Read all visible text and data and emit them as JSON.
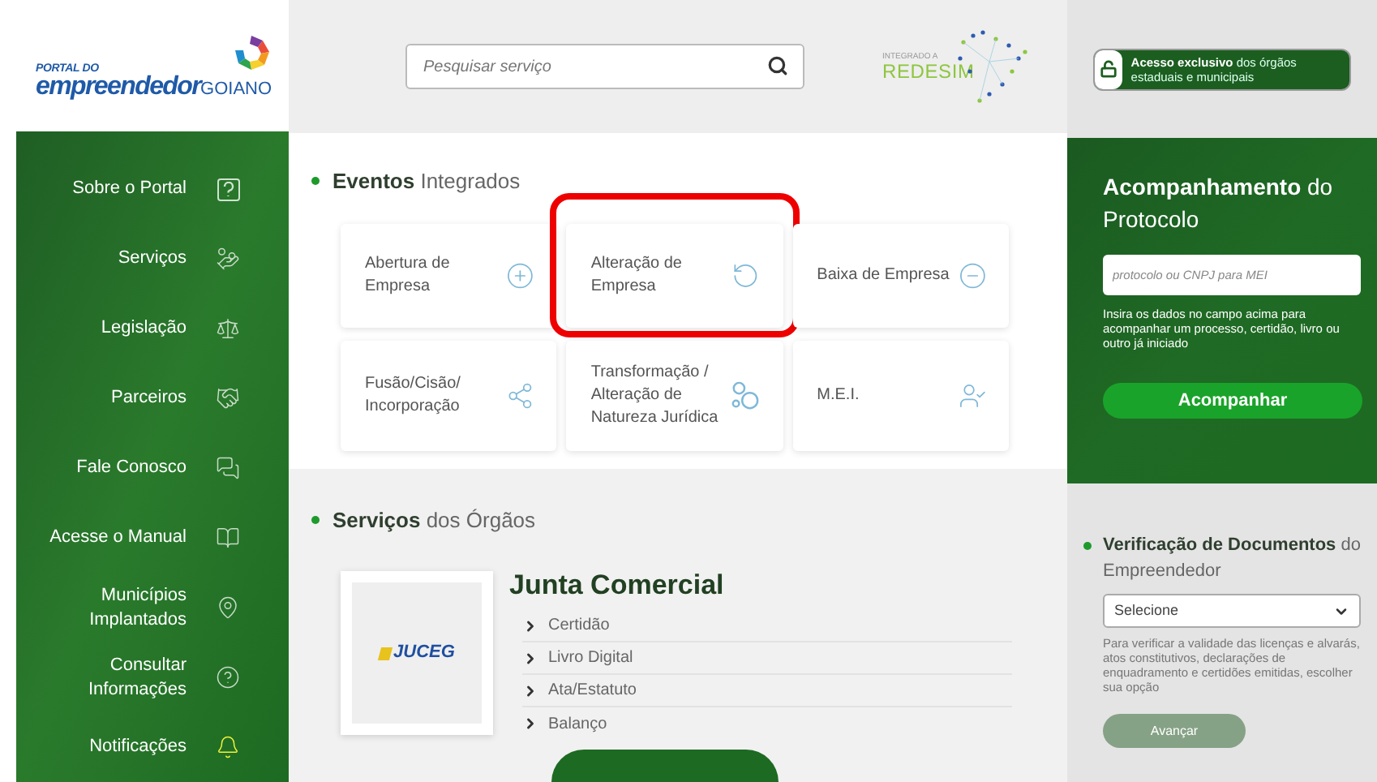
{
  "logo": {
    "top": "PORTAL DO",
    "main": "empreendedor",
    "suffix": "GOIANO"
  },
  "search": {
    "placeholder": "Pesquisar serviço"
  },
  "redesim": {
    "caption": "INTEGRADO A",
    "name": "REDESIM"
  },
  "access_button": {
    "bold": "Acesso exclusivo",
    "rest": "dos órgãos estaduais e municipais"
  },
  "sidebar": {
    "items": [
      {
        "label": "Sobre o Portal"
      },
      {
        "label": "Serviços"
      },
      {
        "label": "Legislação"
      },
      {
        "label": "Parceiros"
      },
      {
        "label": "Fale Conosco"
      },
      {
        "label": "Acesse o Manual"
      },
      {
        "label": "Municípios Implantados"
      },
      {
        "label": "Consultar Informações"
      },
      {
        "label": "Notificações"
      }
    ]
  },
  "events": {
    "title_bold": "Eventos",
    "title_rest": "Integrados",
    "cards": [
      {
        "label": "Abertura de Empresa",
        "highlighted": false
      },
      {
        "label": "Alteração de Empresa",
        "highlighted": true
      },
      {
        "label": "Baixa de Empresa",
        "highlighted": false
      },
      {
        "label": "Fusão/Cisão/ Incorporação",
        "highlighted": false
      },
      {
        "label": "Transformação / Alteração de Natureza Jurídica",
        "highlighted": false
      },
      {
        "label": "M.E.I.",
        "highlighted": false
      }
    ]
  },
  "services": {
    "title_bold": "Serviços",
    "title_rest": "dos Órgãos",
    "organ": {
      "logo": "JUCEG",
      "name": "Junta Comercial",
      "links": [
        "Certidão",
        "Livro Digital",
        "Ata/Estatuto",
        "Balanço"
      ]
    }
  },
  "tracking": {
    "title_bold": "Acompanhamento",
    "title_rest": "do Protocolo",
    "placeholder": "protocolo ou CNPJ para MEI",
    "help": "Insira os dados no campo acima para acompanhar um processo, certidão, livro ou outro já iniciado",
    "button": "Acompanhar"
  },
  "verification": {
    "title_bold": "Verificação de Documentos",
    "title_rest": "do Empreendedor",
    "select": "Selecione",
    "help": "Para verificar a validade das licenças e alvarás, atos constitutivos, declarações de enquadramento e certidões emitidas, escolher sua opção",
    "button": "Avançar",
    "button_disabled": true
  }
}
